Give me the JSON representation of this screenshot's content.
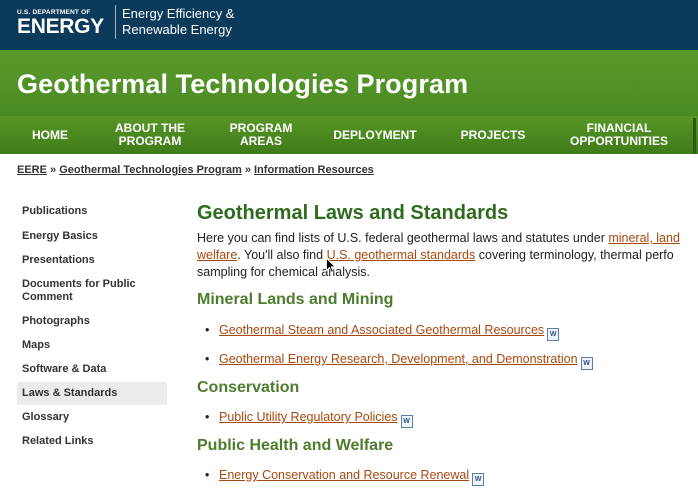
{
  "header": {
    "doe_small": "U.S. DEPARTMENT OF",
    "doe_big": "ENERGY",
    "eere_line1": "Energy Efficiency &",
    "eere_line2": "Renewable Energy"
  },
  "banner": {
    "title": "Geothermal Technologies Program"
  },
  "nav": [
    {
      "label": "HOME"
    },
    {
      "label": "ABOUT THE\nPROGRAM"
    },
    {
      "label": "PROGRAM\nAREAS"
    },
    {
      "label": "DEPLOYMENT"
    },
    {
      "label": "PROJECTS"
    },
    {
      "label": "FINANCIAL\nOPPORTUNITIES"
    }
  ],
  "breadcrumb": {
    "items": [
      "EERE",
      "Geothermal Technologies Program",
      "Information Resources"
    ],
    "sep": " » "
  },
  "sidebar": {
    "items": [
      {
        "label": "Publications"
      },
      {
        "label": "Energy Basics"
      },
      {
        "label": "Presentations"
      },
      {
        "label": "Documents for Public Comment"
      },
      {
        "label": "Photographs"
      },
      {
        "label": "Maps"
      },
      {
        "label": "Software & Data"
      },
      {
        "label": "Laws & Standards"
      },
      {
        "label": "Glossary"
      },
      {
        "label": "Related Links"
      }
    ],
    "active": "Laws & Standards"
  },
  "content": {
    "title": "Geothermal Laws and Standards",
    "intro_1a": "Here you can find lists of U.S. federal geothermal laws and statutes under ",
    "intro_1_link": "mineral, land",
    "intro_2_link": "welfare",
    "intro_2a": ". You'll also find ",
    "intro_2_link2": "U.S. geothermal standards",
    "intro_2b": " covering terminology, thermal perfo",
    "intro_3": "sampling for chemical analysis.",
    "sections": [
      {
        "heading": "Mineral Lands and Mining",
        "links": [
          "Geothermal Steam and Associated Geothermal Resources",
          "Geothermal Energy Research, Development, and Demonstration"
        ]
      },
      {
        "heading": "Conservation",
        "links": [
          "Public Utility Regulatory Policies"
        ]
      },
      {
        "heading": "Public Health and Welfare",
        "links": [
          "Energy Conservation and Resource Renewal"
        ]
      }
    ],
    "doc_icon_glyph": "W"
  }
}
